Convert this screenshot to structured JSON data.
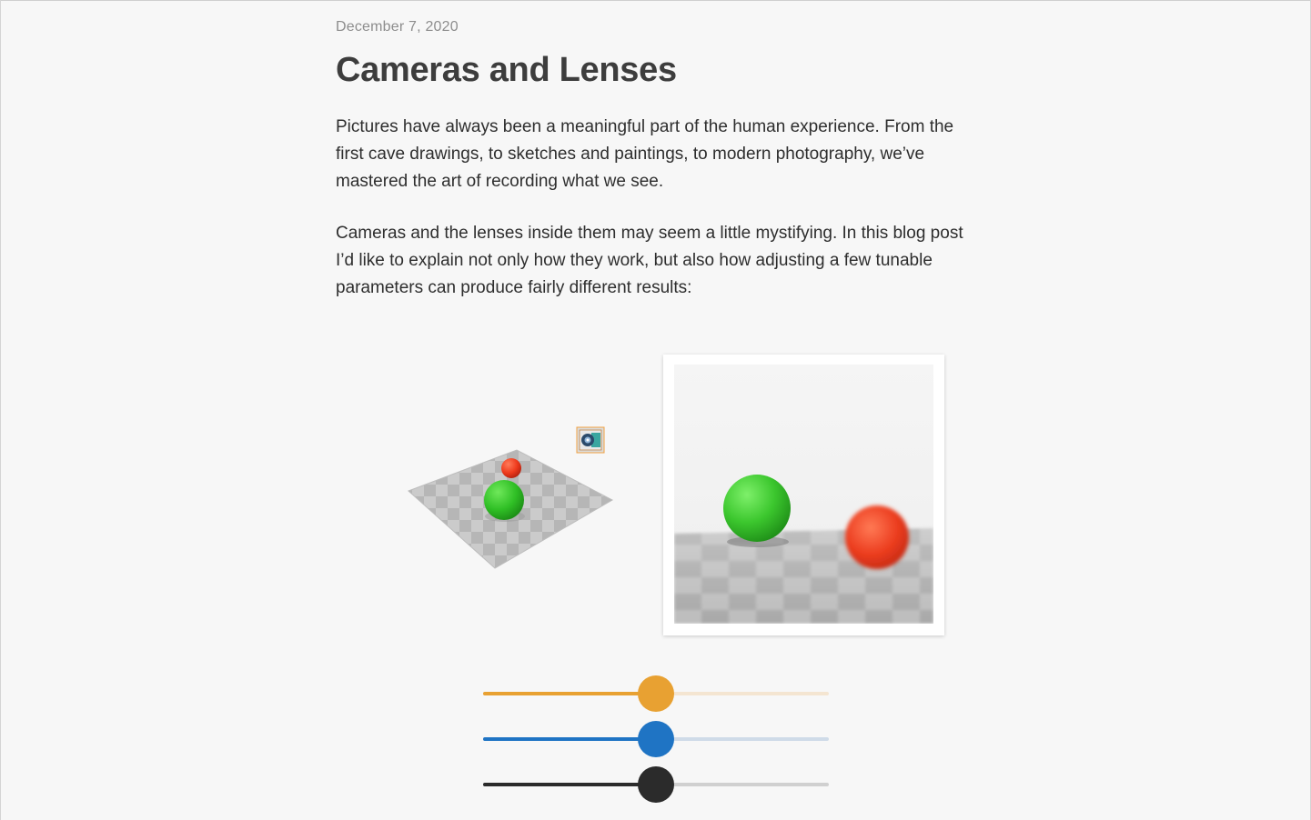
{
  "article": {
    "date": "December 7, 2020",
    "title": "Cameras and Lenses",
    "paragraphs": [
      "Pictures have always been a meaningful part of the human experience. From the first cave drawings, to sketches and paintings, to modern photography, we’ve mastered the art of recording what we see.",
      "Cameras and the lenses inside them may seem a little mystifying. In this blog post I’d like to explain not only how they work, but also how adjusting a few tunable parameters can produce fairly different results:"
    ]
  },
  "demo": {
    "scene_icons": [
      "checkerboard-floor",
      "green-sphere",
      "red-sphere",
      "camera-icon"
    ],
    "sliders": [
      {
        "name": "orange-slider",
        "value": 0.5,
        "color": "#e8a132",
        "track_color": "#f4e5d1"
      },
      {
        "name": "blue-slider",
        "value": 0.5,
        "color": "#1f74c4",
        "track_color": "#cfdbe8"
      },
      {
        "name": "black-slider",
        "value": 0.5,
        "color": "#2b2b2b",
        "track_color": "#d0d0d0"
      }
    ]
  }
}
